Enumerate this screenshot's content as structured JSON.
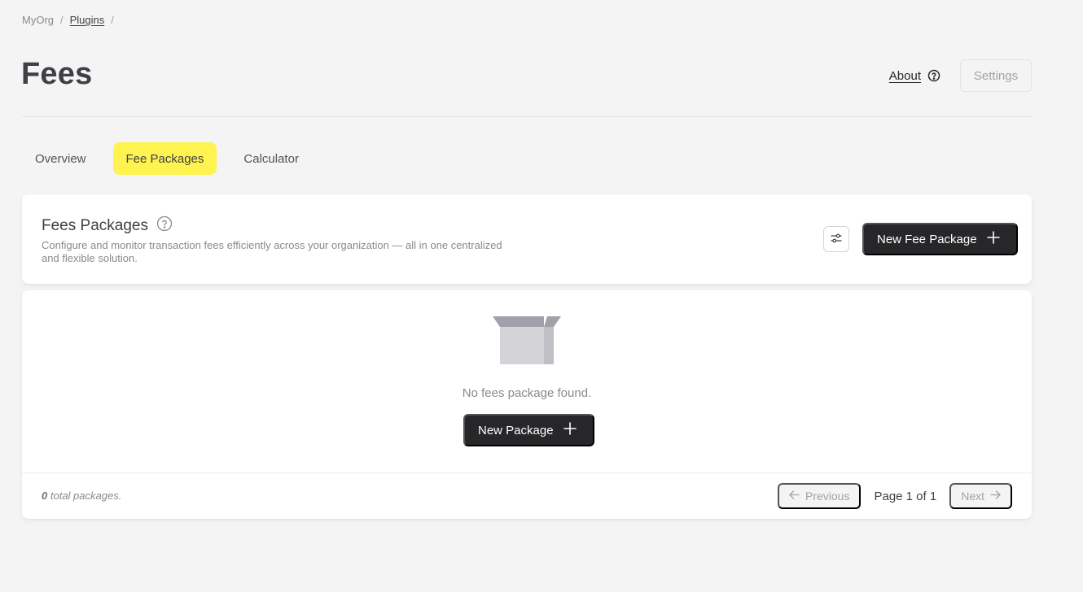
{
  "breadcrumb": {
    "org": "MyOrg",
    "separator": "/",
    "plugins": "Plugins"
  },
  "header": {
    "title": "Fees",
    "about_label": "About",
    "about_icon": "help-circle-icon",
    "settings_label": "Settings"
  },
  "tabs": [
    {
      "label": "Overview",
      "active": false
    },
    {
      "label": "Fee Packages",
      "active": true
    },
    {
      "label": "Calculator",
      "active": false
    }
  ],
  "packages_header": {
    "title": "Fees Packages",
    "title_icon": "help-circle-icon",
    "description": "Configure and monitor transaction fees efficiently across your organization — all in one centralized and flexible solution.",
    "filter_icon": "sliders-icon",
    "new_button_label": "New Fee Package",
    "new_button_icon": "plus-icon"
  },
  "empty_state": {
    "icon": "empty-box-icon",
    "message": "No fees package found.",
    "button_label": "New Package",
    "button_icon": "plus-icon"
  },
  "footer": {
    "total_count": "0",
    "total_suffix": "total packages.",
    "previous_label": "Previous",
    "page_info": "Page 1 of 1",
    "next_label": "Next"
  },
  "colors": {
    "background": "#f4f4f4",
    "active_tab": "#fef34f",
    "primary_button": "#27272a",
    "text_primary": "#3f3f46",
    "text_muted": "#8a8a8f"
  }
}
